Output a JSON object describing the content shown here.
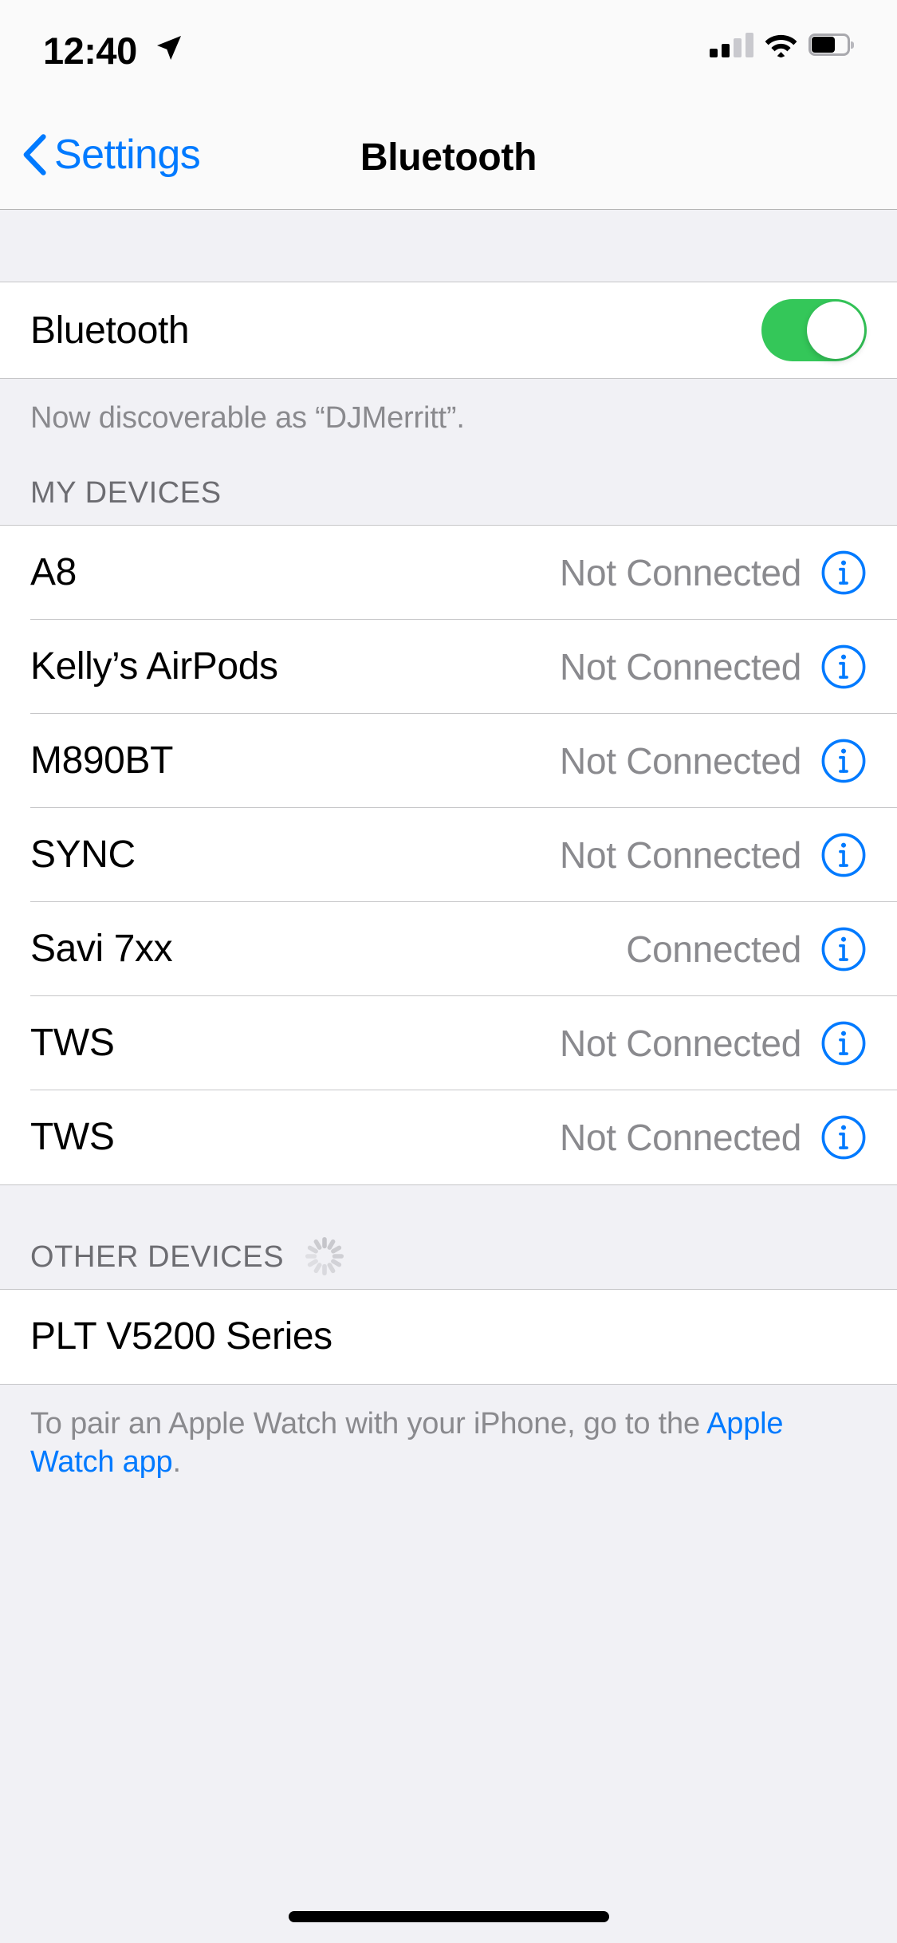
{
  "status_bar": {
    "time": "12:40",
    "location_icon": "location-arrow-icon",
    "signal_bars_filled": 2,
    "signal_bars_total": 4,
    "wifi_icon": "wifi-icon",
    "battery_icon": "battery-icon",
    "battery_level_percent": 62
  },
  "nav": {
    "back_label": "Settings",
    "back_icon": "chevron-left-icon",
    "title": "Bluetooth"
  },
  "bluetooth_toggle": {
    "label": "Bluetooth",
    "state": "on",
    "on_color": "#34c759"
  },
  "discoverable_note": "Now discoverable as “DJMerritt”.",
  "my_devices": {
    "header": "MY DEVICES",
    "rows": [
      {
        "name": "A8",
        "status": "Not Connected",
        "info_icon": "info-circle-icon"
      },
      {
        "name": "Kelly’s AirPods",
        "status": "Not Connected",
        "info_icon": "info-circle-icon"
      },
      {
        "name": "M890BT",
        "status": "Not Connected",
        "info_icon": "info-circle-icon"
      },
      {
        "name": "SYNC",
        "status": "Not Connected",
        "info_icon": "info-circle-icon"
      },
      {
        "name": "Savi 7xx",
        "status": "Connected",
        "info_icon": "info-circle-icon"
      },
      {
        "name": "TWS",
        "status": "Not Connected",
        "info_icon": "info-circle-icon"
      },
      {
        "name": "TWS",
        "status": "Not Connected",
        "info_icon": "info-circle-icon"
      }
    ]
  },
  "other_devices": {
    "header": "OTHER DEVICES",
    "spinner_icon": "activity-spinner-icon",
    "rows": [
      {
        "name": "PLT V5200 Series"
      }
    ]
  },
  "footer": {
    "text_before_link": "To pair an Apple Watch with your iPhone, go to the ",
    "link_text": "Apple Watch app",
    "text_after_link": ".",
    "link_color": "#007aff"
  },
  "home_indicator": "home-indicator"
}
